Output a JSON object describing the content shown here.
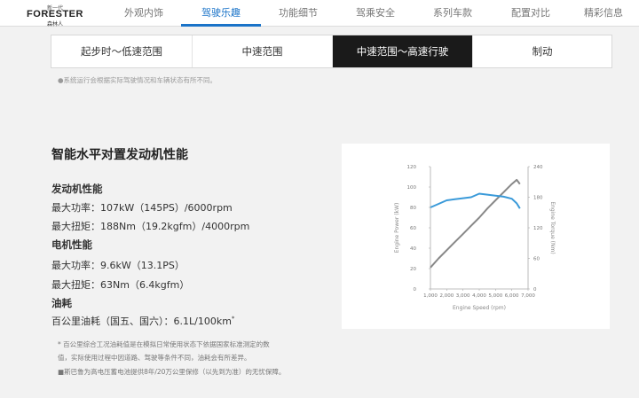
{
  "logo": {
    "small": "新一代",
    "main": "FORESTER",
    "cn": "森林人"
  },
  "nav": {
    "items": [
      "外观内饰",
      "驾驶乐趣",
      "功能细节",
      "驾乘安全",
      "系列车款",
      "配置对比",
      "精彩信息"
    ],
    "active_index": 1
  },
  "subtabs": {
    "items": [
      "起步时～低速范围",
      "中速范围",
      "中速范围～高速行驶",
      "制动"
    ],
    "active_index": 2
  },
  "notice": "●系统运行会根据实际驾驶情况和车辆状态有所不同。",
  "performance": {
    "title": "智能水平对置发动机性能",
    "engine_heading": "发动机性能",
    "engine_power": "最大功率：107kW（145PS）/6000rpm",
    "engine_torque": "最大扭矩：188Nm（19.2kgfm）/4000rpm",
    "motor_heading": "电机性能",
    "motor_power": "最大功率：9.6kW（13.1PS）",
    "motor_torque": "最大扭矩：63Nm（6.4kgfm）",
    "fuel_heading": "油耗",
    "fuel_value": "百公里油耗（国五、国六）：6.1L/100km",
    "fuel_mark": "*"
  },
  "footnotes": [
    "* 百公里综合工况油耗值是在模拟日常使用状态下依据国家标准测定的数",
    "值，实际使用过程中因道路、驾驶等条件不同，油耗会有所差异。",
    "■斯巴鲁为高电压蓄电池提供8年/20万公里保修（以先到为准）的无忧保障。"
  ],
  "chart_data": {
    "type": "line",
    "xlabel": "Engine Speed (rpm)",
    "ylabel_left": "Engine Power (kW)",
    "ylabel_right": "Engine Torque (Nm)",
    "xlim": [
      1000,
      7000
    ],
    "ylim_left": [
      0,
      120
    ],
    "ylim_right": [
      0,
      240
    ],
    "x_ticks": [
      "1,000",
      "2,000",
      "3,000",
      "4,000",
      "5,000",
      "6,000",
      "7,000"
    ],
    "y_left_ticks": [
      "0",
      "20",
      "40",
      "60",
      "80",
      "100",
      "120"
    ],
    "y_right_ticks": [
      "0",
      "60",
      "120",
      "180",
      "240"
    ],
    "series": [
      {
        "axis": "left",
        "color": "#888888",
        "x": [
          1000,
          1500,
          2000,
          2500,
          3000,
          3500,
          4000,
          4500,
          5000,
          5500,
          6000,
          6300,
          6500
        ],
        "y": [
          21,
          30,
          38,
          46,
          54,
          62,
          70,
          79,
          87,
          95,
          103,
          107,
          103
        ]
      },
      {
        "axis": "right",
        "color": "#3a9ad9",
        "x": [
          1000,
          1500,
          2000,
          2500,
          3000,
          3500,
          4000,
          4500,
          5000,
          5500,
          6000,
          6300,
          6500
        ],
        "y": [
          160,
          167,
          174,
          176,
          178,
          180,
          187,
          185,
          183,
          181,
          177,
          168,
          158
        ]
      }
    ]
  }
}
